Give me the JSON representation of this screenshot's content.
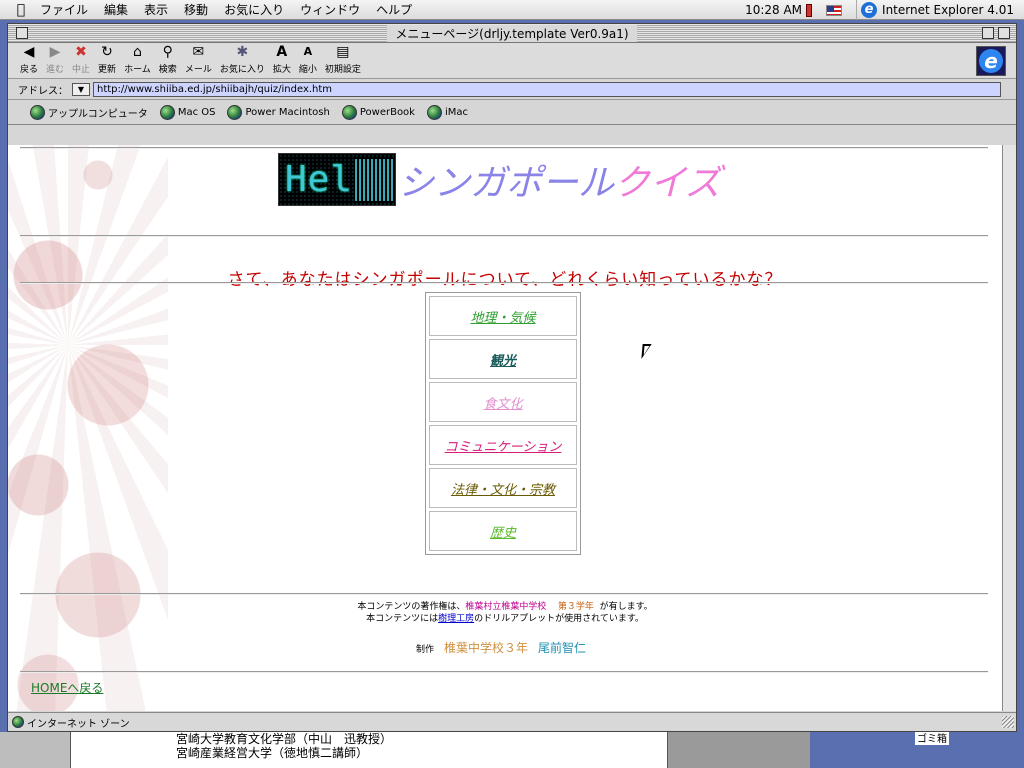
{
  "menubar": {
    "menus": [
      "ファイル",
      "編集",
      "表示",
      "移動",
      "お気に入り",
      "ウィンドウ",
      "ヘルプ"
    ],
    "clock": "10:28 AM",
    "app_name": "Internet Explorer 4.01"
  },
  "window": {
    "title": "メニューページ(drljy.template Ver0.9a1)"
  },
  "toolbar": {
    "buttons": [
      {
        "label": "戻る",
        "icon": "back-arrow-icon",
        "enabled": true
      },
      {
        "label": "進む",
        "icon": "forward-arrow-icon",
        "enabled": false
      },
      {
        "label": "中止",
        "icon": "stop-icon",
        "enabled": false
      },
      {
        "label": "更新",
        "icon": "refresh-icon",
        "enabled": true
      },
      {
        "label": "ホーム",
        "icon": "home-icon",
        "enabled": true
      },
      {
        "label": "検索",
        "icon": "search-icon",
        "enabled": true
      },
      {
        "label": "メール",
        "icon": "mail-icon",
        "enabled": true
      },
      {
        "label": "お気に入り",
        "icon": "favorites-icon",
        "enabled": true
      },
      {
        "label": "拡大",
        "icon": "larger-text-icon",
        "enabled": true
      },
      {
        "label": "縮小",
        "icon": "smaller-text-icon",
        "enabled": true
      },
      {
        "label": "初期設定",
        "icon": "preferences-icon",
        "enabled": true
      }
    ]
  },
  "address": {
    "label": "アドレス：",
    "url": "http://www.shiiba.ed.jp/shiibajh/quiz/index.htm"
  },
  "favorites_bar": {
    "items": [
      "アップルコンピュータ",
      "Mac OS",
      "Power Macintosh",
      "PowerBook",
      "iMac"
    ]
  },
  "page": {
    "logo_text": "Hel",
    "title_main": "シンガポール",
    "title_accent": "クイズ",
    "question": "さて、あなたはシンガポールについて、どれくらい知っているかな？",
    "menu": [
      {
        "label": "地理・気候",
        "color": "#2e9e2e"
      },
      {
        "label": "観光",
        "color": "#1a5a5a"
      },
      {
        "label": "食文化",
        "color": "#e090d0"
      },
      {
        "label": "コミュニケーション",
        "color": "#d81b7a"
      },
      {
        "label": "法律・文化・宗教",
        "color": "#6a5a00"
      },
      {
        "label": "歴史",
        "color": "#5ab82a"
      }
    ],
    "copyright_prefix": "本コンテンツの著作権は、",
    "copyright_owner": "椎葉村立椎葉中学校",
    "copyright_grade": "第３学年",
    "copyright_suffix": "が有します。",
    "applet_prefix": "本コンテンツには",
    "applet_link": "樹理工房",
    "applet_suffix": "のドリルアプレットが使用されています。",
    "credit_label": "制作",
    "credit_school": "椎葉中学校３年",
    "credit_name": "尾前智仁",
    "home_link": "HOMEへ戻る"
  },
  "status": {
    "zone": "インターネット ゾーン"
  },
  "desktop": {
    "doc_lines": [
      "宮崎大学教育文化学部（中山　迅教授）",
      "宮崎産業経営大学（徳地慎二講師）"
    ],
    "trash_label": "ゴミ箱"
  },
  "colors": {
    "title_main": "#8a84e8",
    "title_accent": "#f07ad8",
    "question": "#c40000",
    "address_bg": "#ccd4ff"
  }
}
